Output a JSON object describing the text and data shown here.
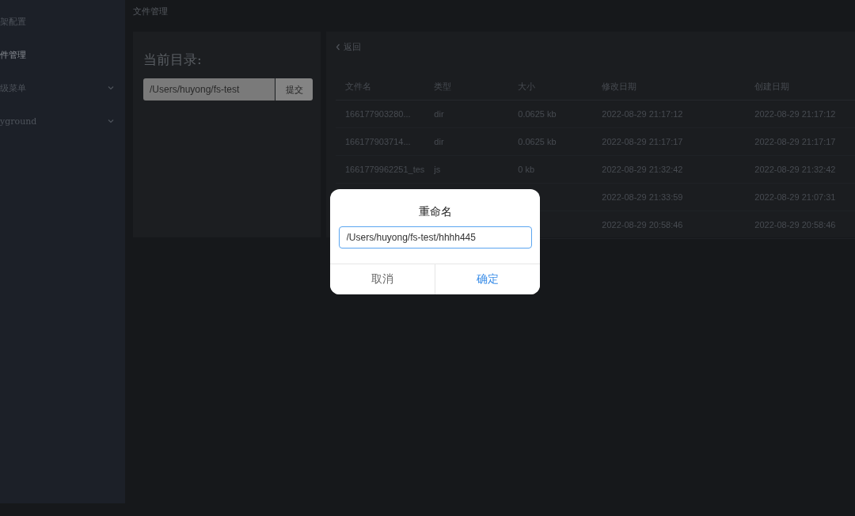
{
  "sidebar": {
    "items": [
      {
        "label": "架配置",
        "selected": false,
        "has_submenu": false
      },
      {
        "label": "件管理",
        "selected": true,
        "has_submenu": false
      },
      {
        "label": "级菜单",
        "selected": false,
        "has_submenu": true
      },
      {
        "label": "yground",
        "selected": false,
        "has_submenu": true
      }
    ]
  },
  "breadcrumb": "文件管理",
  "directory_panel": {
    "title": "当前目录:",
    "path_value": "/Users/huyong/fs-test",
    "submit_button": "提交"
  },
  "file_panel": {
    "back_link": "返回",
    "table": {
      "columns": [
        "文件名",
        "类型",
        "大小",
        "修改日期",
        "创建日期"
      ],
      "rows": [
        {
          "name": "166177903280...",
          "type": "dir",
          "size": "0.0625 kb",
          "modified": "2022-08-29 21:17:12",
          "created": "2022-08-29 21:17:12"
        },
        {
          "name": "166177903714...",
          "type": "dir",
          "size": "0.0625 kb",
          "modified": "2022-08-29 21:17:17",
          "created": "2022-08-29 21:17:17"
        },
        {
          "name": "1661779962251_tes",
          "type": "js",
          "size": "0 kb",
          "modified": "2022-08-29 21:32:42",
          "created": "2022-08-29 21:32:42"
        },
        {
          "modified": "2022-08-29 21:33:59",
          "created": "2022-08-29 21:07:31"
        },
        {
          "modified": "2022-08-29 20:58:46",
          "created": "2022-08-29 20:58:46"
        }
      ]
    }
  },
  "dialog": {
    "title": "重命名",
    "input_value": "/Users/huyong/fs-test/hhhh445",
    "cancel_button": "取消",
    "confirm_button": "确定"
  }
}
